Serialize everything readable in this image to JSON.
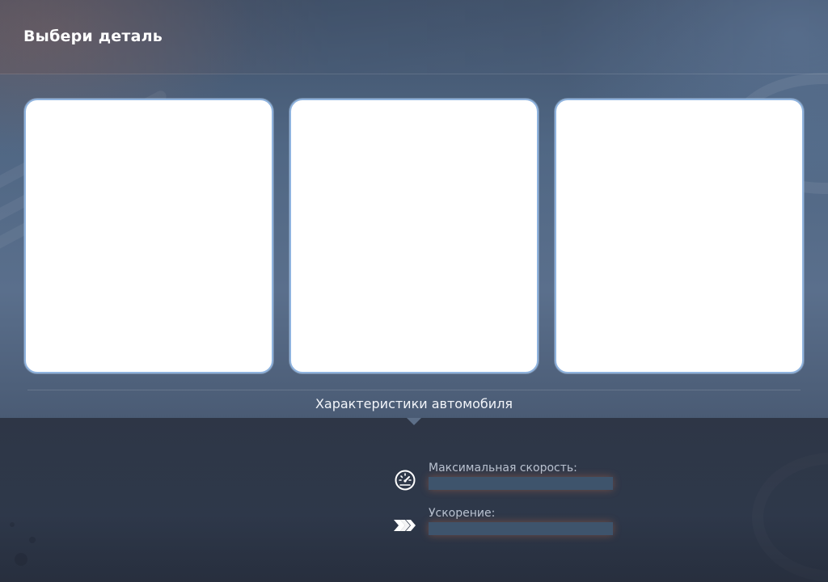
{
  "header": {
    "title": "Выбери деталь"
  },
  "cards": [
    {
      "name": "part-card-1"
    },
    {
      "name": "part-card-2"
    },
    {
      "name": "part-card-3"
    }
  ],
  "section": {
    "label": "Характеристики автомобиля"
  },
  "stats": [
    {
      "label": "Максимальная скорость:",
      "icon": "speedometer-icon",
      "level": 0
    },
    {
      "label": "Ускорение:",
      "icon": "acceleration-chevrons-icon",
      "level": 0
    }
  ],
  "colors": {
    "card_border": "#8fb3de",
    "stat_bar": "#3e546c",
    "accent_glow": "#c86e46"
  }
}
